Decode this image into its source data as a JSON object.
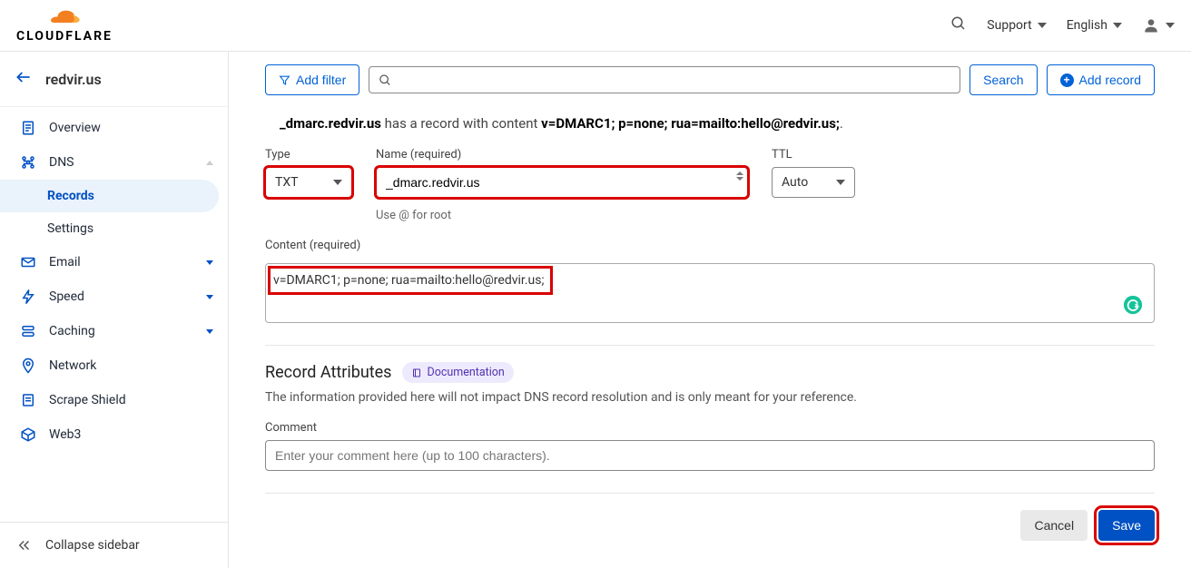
{
  "brand": {
    "name": "CLOUDFLARE"
  },
  "topnav": {
    "support": "Support",
    "language": "English"
  },
  "domain": "redvir.us",
  "sidebar": {
    "overview": "Overview",
    "dns": "DNS",
    "records": "Records",
    "settings": "Settings",
    "email": "Email",
    "speed": "Speed",
    "caching": "Caching",
    "network": "Network",
    "scrape": "Scrape Shield",
    "web3": "Web3",
    "collapse": "Collapse sidebar"
  },
  "toolbar": {
    "add_filter": "Add filter",
    "search": "Search",
    "add_record": "Add record"
  },
  "info": {
    "host": "_dmarc.redvir.us",
    "mid": " has a record with content ",
    "content": "v=DMARC1; p=none; rua=mailto:hello@redvir.us;",
    "end": "."
  },
  "form": {
    "type_label": "Type",
    "type_value": "TXT",
    "name_label": "Name (required)",
    "name_value": "_dmarc.redvir.us",
    "name_helper": "Use @ for root",
    "ttl_label": "TTL",
    "ttl_value": "Auto",
    "content_label": "Content (required)",
    "content_value": "v=DMARC1; p=none; rua=mailto:hello@redvir.us;"
  },
  "attrs": {
    "heading": "Record Attributes",
    "doc": "Documentation",
    "desc": "The information provided here will not impact DNS record resolution and is only meant for your reference.",
    "comment_label": "Comment",
    "comment_placeholder": "Enter your comment here (up to 100 characters)."
  },
  "footer": {
    "cancel": "Cancel",
    "save": "Save"
  }
}
